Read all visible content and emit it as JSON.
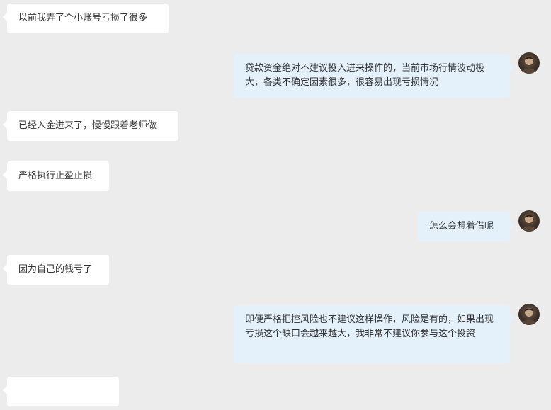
{
  "messages": [
    {
      "side": "left",
      "text": "以前我弄了个小账号亏损了很多"
    },
    {
      "side": "right",
      "text": "贷款资金绝对不建议投入进来操作的，当前市场行情波动极大，各类不确定因素很多，很容易出现亏损情况"
    },
    {
      "side": "left",
      "text": "已经入金进来了，慢慢跟着老师做"
    },
    {
      "side": "left",
      "text": "严格执行止盈止损"
    },
    {
      "side": "right",
      "text": "怎么会想着借呢"
    },
    {
      "side": "left",
      "text": "因为自己的钱亏了"
    },
    {
      "side": "right",
      "text": "即便严格把控风险也不建议这样操作，风险是有的，如果出现亏损这个缺口会越来越大，我非常不建议你参与这个投资"
    },
    {
      "side": "left",
      "text": ""
    }
  ],
  "colors": {
    "background": "#ececec",
    "left_bubble": "#ffffff",
    "right_bubble": "#e4f1fb",
    "text": "#333333"
  }
}
